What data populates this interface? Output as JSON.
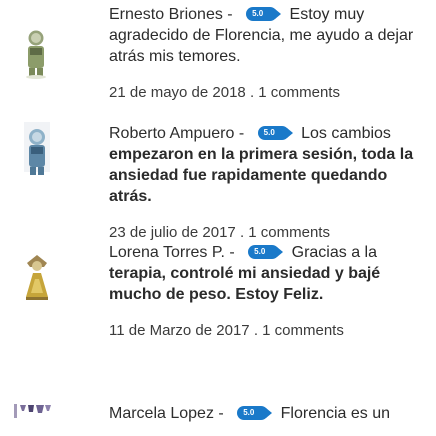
{
  "reviews": [
    {
      "author": "Ernesto Briones",
      "separator": "-",
      "score": "5.0",
      "text_first": "Estoy muy",
      "text_rest": "agradecido de Florencia, me ayudo a dejar atrás mis temores.",
      "date": "21 de mayo de 2018 . 1 comments"
    },
    {
      "author": "Roberto Ampuero",
      "separator": "-",
      "score": "5.0",
      "text_first": "Los cambios",
      "text_rest": "empezaron en la primera sesión, toda la ansiedad fue rapidamente quedando atrás.",
      "date": "23 de julio de 2017 . 1 comments"
    },
    {
      "author": "Lorena Torres P.",
      "separator": "-",
      "score": "5.0",
      "text_first": "Gracias a la",
      "text_rest": "terapia, controlé mi ansiedad y bajé mucho de peso. Estoy Feliz.",
      "date": "11 de Marzo de 2017 . 1 comments"
    },
    {
      "author": "Marcela Lopez",
      "separator": "-",
      "score": "5.0",
      "text_first": "Florencia es un",
      "text_rest": "",
      "date": ""
    }
  ],
  "colors": {
    "badge": "#1a79c9",
    "text": "#2b2b2b",
    "meta": "#3b3b3b"
  },
  "icons": [
    "user-avatar-icon-green",
    "user-avatar-icon-blue",
    "user-avatar-icon-yellow",
    "user-avatar-icon-purple"
  ]
}
